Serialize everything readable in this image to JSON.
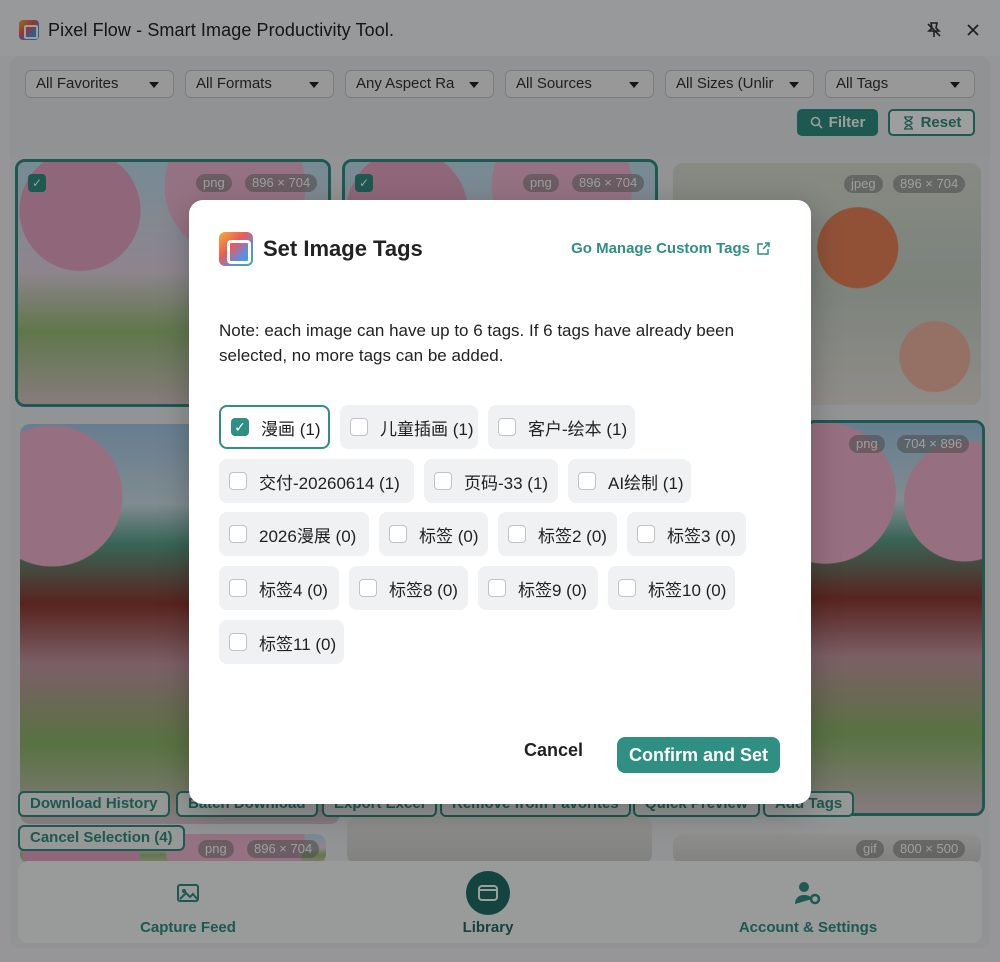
{
  "app": {
    "title": "Pixel Flow - Smart Image Productivity Tool."
  },
  "filters": {
    "favorites": "All Favorites",
    "formats": "All Formats",
    "aspect": "Any Aspect Ra",
    "sources": "All Sources",
    "sizes": "All Sizes (Unlir",
    "tags": "All Tags",
    "filter_label": "Filter",
    "reset_label": "Reset"
  },
  "images": [
    {
      "format": "png",
      "size": "896 × 704"
    },
    {
      "format": "png",
      "size": "896 × 704"
    },
    {
      "format": "jpeg",
      "size": "896 × 704"
    },
    {
      "format": "png",
      "size": "704 × 896"
    },
    {
      "format": "png",
      "size": "896 × 704"
    },
    {
      "format": "gif",
      "size": "800 × 500"
    }
  ],
  "actions": {
    "download_history": "Download History",
    "batch_download": "Batch Download",
    "export_excel": "Export Excel",
    "remove_favorites": "Remove from Favorites",
    "quick_preview": "Quick Preview",
    "add_tags": "Add Tags",
    "cancel_selection": "Cancel Selection (4)"
  },
  "nav": {
    "capture": "Capture Feed",
    "library": "Library",
    "account": "Account & Settings"
  },
  "modal": {
    "title": "Set Image Tags",
    "manage_link": "Go Manage Custom Tags",
    "note": "Note: each image can have up to 6 tags. If 6 tags have already been selected, no more tags can be added.",
    "tags": [
      {
        "label": "漫画 (1)",
        "checked": true
      },
      {
        "label": "儿童插画 (1)",
        "checked": false
      },
      {
        "label": "客户-绘本 (1)",
        "checked": false
      },
      {
        "label": "交付-20260614 (1)",
        "checked": false
      },
      {
        "label": "页码-33 (1)",
        "checked": false
      },
      {
        "label": "AI绘制 (1)",
        "checked": false
      },
      {
        "label": "2026漫展 (0)",
        "checked": false
      },
      {
        "label": "标签 (0)",
        "checked": false
      },
      {
        "label": "标签2 (0)",
        "checked": false
      },
      {
        "label": "标签3 (0)",
        "checked": false
      },
      {
        "label": "标签4 (0)",
        "checked": false
      },
      {
        "label": "标签8 (0)",
        "checked": false
      },
      {
        "label": "标签9 (0)",
        "checked": false
      },
      {
        "label": "标签10 (0)",
        "checked": false
      },
      {
        "label": "标签11 (0)",
        "checked": false
      }
    ],
    "cancel_label": "Cancel",
    "confirm_label": "Confirm and Set"
  }
}
